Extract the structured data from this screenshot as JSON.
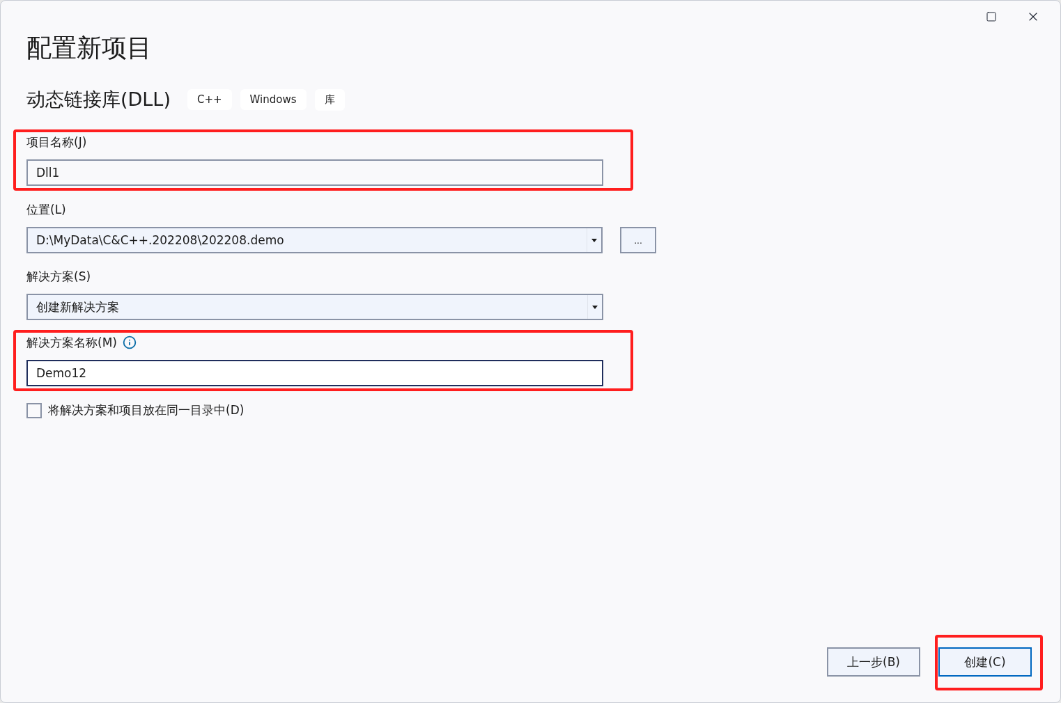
{
  "window": {
    "title": "配置新项目"
  },
  "template": {
    "name": "动态链接库(DLL)",
    "tags": [
      "C++",
      "Windows",
      "库"
    ]
  },
  "fields": [
    {
      "kind": "text",
      "label": "项目名称(J)",
      "value": "Dll1",
      "highlighted": true,
      "focused": false,
      "info": false
    },
    {
      "kind": "combo",
      "label": "位置(L)",
      "value": "D:\\MyData\\C&C++.202208\\202208.demo",
      "highlighted": false,
      "focused": false,
      "info": false,
      "browse": "..."
    },
    {
      "kind": "combo",
      "label": "解决方案(S)",
      "value": "创建新解决方案",
      "highlighted": false,
      "focused": false,
      "info": false
    },
    {
      "kind": "text",
      "label": "解决方案名称(M)",
      "value": "Demo12",
      "highlighted": true,
      "focused": true,
      "info": true
    }
  ],
  "checkbox": {
    "label": "将解决方案和项目放在同一目录中(D)",
    "checked": false
  },
  "buttons": [
    {
      "label": "上一步(B)",
      "default": false,
      "highlighted": false
    },
    {
      "label": "创建(C)",
      "default": true,
      "highlighted": true
    }
  ]
}
